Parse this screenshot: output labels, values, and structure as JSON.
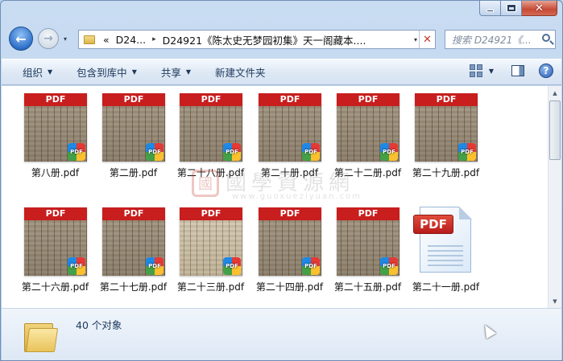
{
  "window": {
    "controls": {
      "minimize": "minimize",
      "maximize": "maximize",
      "close": "✕"
    }
  },
  "nav": {
    "back_icon": "back-arrow-icon",
    "forward_icon": "forward-arrow-icon",
    "recent_arrow": "▾",
    "breadcrumb": {
      "overflow": "«",
      "items": [
        "D24...",
        "D24921《陈太史无梦园初集》天一阁藏本...."
      ],
      "separator": "▸"
    },
    "dropdown": "▾",
    "refresh": "✕",
    "search_placeholder": "搜索 D24921《..."
  },
  "toolbar": {
    "buttons": [
      {
        "label": "组织",
        "has_arrow": true
      },
      {
        "label": "包含到库中",
        "has_arrow": true
      },
      {
        "label": "共享",
        "has_arrow": true
      },
      {
        "label": "新建文件夹",
        "has_arrow": false
      }
    ],
    "arrow_glyph": "▼",
    "help": "?"
  },
  "files": [
    {
      "name": "第八册.pdf",
      "band": "PDF",
      "badge": "PDF",
      "style": "dark"
    },
    {
      "name": "第二册.pdf",
      "band": "PDF",
      "badge": "PDF",
      "style": "dark"
    },
    {
      "name": "第二十八册.pdf",
      "band": "PDF",
      "badge": "PDF",
      "style": "dark"
    },
    {
      "name": "第二十册.pdf",
      "band": "PDF",
      "badge": "PDF",
      "style": "dark"
    },
    {
      "name": "第二十二册.pdf",
      "band": "PDF",
      "badge": "PDF",
      "style": "dark"
    },
    {
      "name": "第二十九册.pdf",
      "band": "PDF",
      "badge": "PDF",
      "style": "dark"
    },
    {
      "name": "第二十六册.pdf",
      "band": "PDF",
      "badge": "PDF",
      "style": "dark"
    },
    {
      "name": "第二十七册.pdf",
      "band": "PDF",
      "badge": "PDF",
      "style": "dark"
    },
    {
      "name": "第二十三册.pdf",
      "band": "PDF",
      "badge": "PDF",
      "style": "light"
    },
    {
      "name": "第二十四册.pdf",
      "band": "PDF",
      "badge": "PDF",
      "style": "dark"
    },
    {
      "name": "第二十五册.pdf",
      "band": "PDF",
      "badge": "PDF",
      "style": "dark"
    },
    {
      "name": "第二十一册.pdf",
      "band": "PDF",
      "badge": "PDF",
      "style": "generic"
    }
  ],
  "watermark": {
    "seal": "國",
    "text": "國學資源網",
    "url": "www.guoxueziyuan.com"
  },
  "status": {
    "count": "40 个对象"
  }
}
